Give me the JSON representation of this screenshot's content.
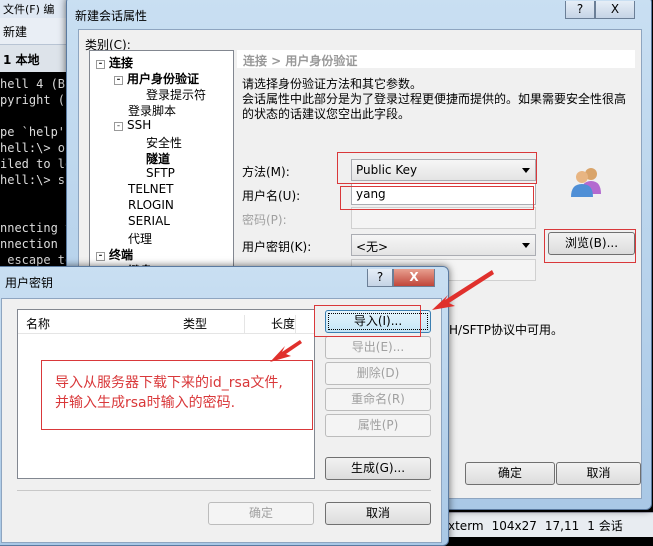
{
  "app": {
    "menu": "文件(F)  编",
    "toolbar_new": "新建",
    "tab": "1 本地",
    "terminal_lines": [
      "hell 4 (Bu",
      "pyright (c",
      "",
      "pe `help' ",
      "hell:\\> op",
      "iled to lo",
      "hell:\\> ss",
      "",
      "",
      "nnecting t",
      "nnection c",
      " escape to"
    ],
    "status": [
      "xterm",
      "104x27",
      "17,11",
      "1 会话"
    ]
  },
  "session_dialog": {
    "title": "新建会话属性",
    "help": "?",
    "close": "X",
    "category_label": "类别(C):",
    "tree": [
      {
        "label": "连接",
        "bold": true,
        "expander": "⊟"
      },
      {
        "label": "用户身份验证",
        "bold": true,
        "expander": "⊟"
      },
      {
        "label": "登录提示符"
      },
      {
        "label": "登录脚本"
      },
      {
        "label": "SSH",
        "expander": "⊟"
      },
      {
        "label": "安全性"
      },
      {
        "label": "隧道",
        "bold": true
      },
      {
        "label": "SFTP"
      },
      {
        "label": "TELNET"
      },
      {
        "label": "RLOGIN"
      },
      {
        "label": "SERIAL"
      },
      {
        "label": "代理"
      },
      {
        "label": "终端",
        "bold": true,
        "expander": "⊟"
      },
      {
        "label": "键盘",
        "bold": true
      }
    ],
    "breadcrumb": "连接 > 用户身份验证",
    "desc1": "请选择身份验证方法和其它参数。",
    "desc2": "会话属性中此部分是为了登录过程更便捷而提供的。如果需要安全性很高的状态的话建议您空出此字段。",
    "method_label": "方法(M):",
    "method_value": "Public Key",
    "username_label": "用户名(U):",
    "username_value": "yang",
    "password_label": "密码(P):",
    "password_value": "",
    "userkey_label": "用户密钥(K):",
    "userkey_value": "<无>",
    "browse": "浏览(B)...",
    "note": "H/SFTP协议中可用。",
    "ok": "确定",
    "cancel": "取消"
  },
  "key_dialog": {
    "title": "用户密钥",
    "help": "?",
    "close": "X",
    "columns": [
      "名称",
      "类型",
      "长度"
    ],
    "buttons": {
      "import": "导入(I)...",
      "export": "导出(E)...",
      "delete": "删除(D)",
      "rename": "重命名(R)",
      "properties": "属性(P)",
      "generate": "生成(G)..."
    },
    "ok": "确定",
    "cancel": "取消"
  },
  "annotation": {
    "line1": "导入从服务器下载下来的id_rsa文件,",
    "line2": "并输入生成rsa时输入的密码.",
    "color": "#d9383a"
  }
}
